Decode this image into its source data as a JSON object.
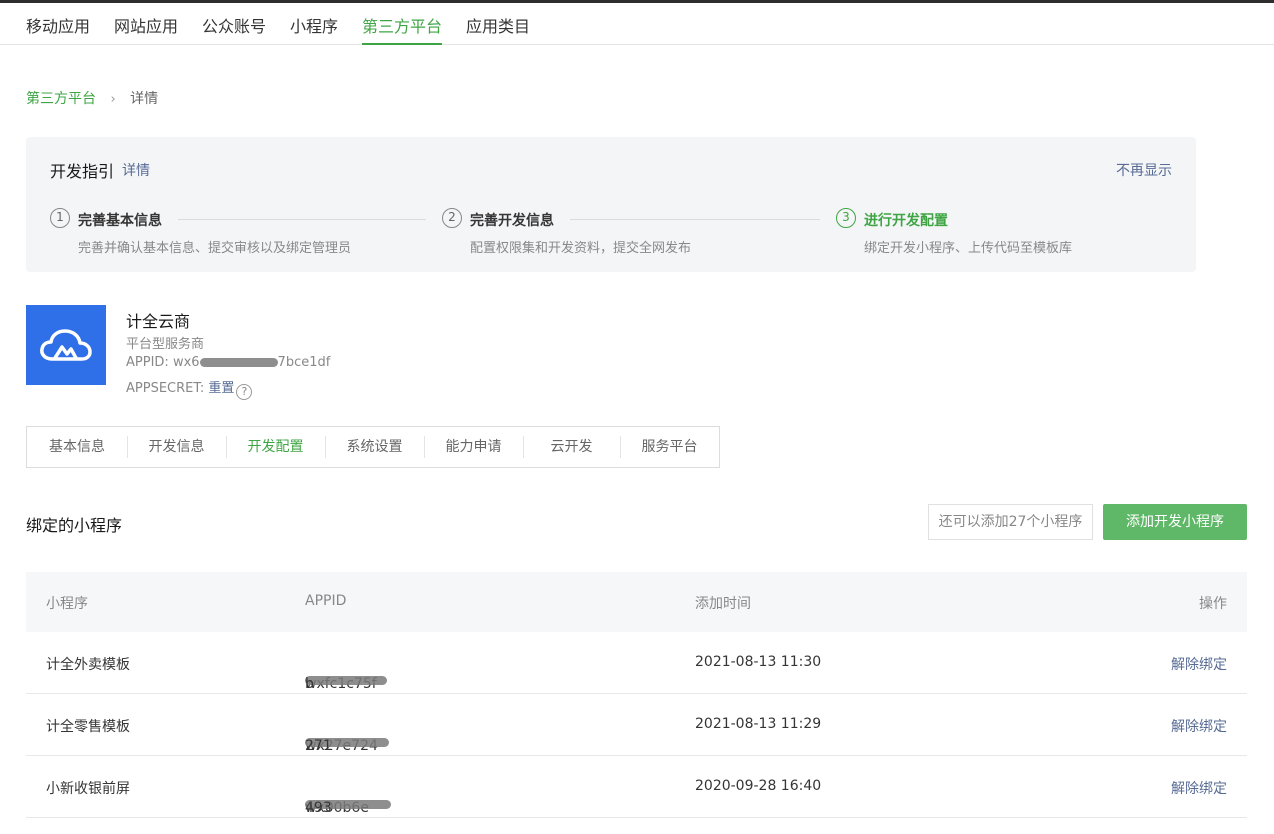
{
  "topnav": {
    "tabs": [
      "移动应用",
      "网站应用",
      "公众账号",
      "小程序",
      "第三方平台",
      "应用类目"
    ],
    "active": "第三方平台"
  },
  "breadcrumb": {
    "parent": "第三方平台",
    "separator": "›",
    "current": "详情"
  },
  "guide": {
    "title": "开发指引",
    "detail_link": "详情",
    "hide_link": "不再显示",
    "steps": [
      {
        "num": "1",
        "title": "完善基本信息",
        "desc": "完善并确认基本信息、提交审核以及绑定管理员"
      },
      {
        "num": "2",
        "title": "完善开发信息",
        "desc": "配置权限集和开发资料，提交全网发布"
      },
      {
        "num": "3",
        "title": "进行开发配置",
        "desc": "绑定开发小程序、上传代码至模板库"
      }
    ]
  },
  "platform": {
    "name": "计全云商",
    "type": "平台型服务商",
    "appid_label": "APPID: ",
    "appid_prefix": "wx6",
    "appid_suffix": "7bce1df",
    "appsecret_label": "APPSECRET: ",
    "reset_link": "重置",
    "help_icon": "?"
  },
  "subtabs": {
    "items": [
      "基本信息",
      "开发信息",
      "开发配置",
      "系统设置",
      "能力申请",
      "云开发",
      "服务平台"
    ],
    "active": "开发配置"
  },
  "bound": {
    "title": "绑定的小程序",
    "remain_text": "还可以添加27个小程序",
    "add_button": "添加开发小程序"
  },
  "table": {
    "headers": [
      "小程序",
      "APPID",
      "添加时间",
      "操作"
    ],
    "rows": [
      {
        "name": "计全外卖模板",
        "appid_prefix": "wxfc1c75f",
        "appid_suffix": "b",
        "time": "2021-08-13 11:30",
        "action": "解除绑定"
      },
      {
        "name": "计全零售模板",
        "appid_prefix": "wx27e724",
        "appid_suffix": "271",
        "time": "2021-08-13 11:29",
        "action": "解除绑定"
      },
      {
        "name": "小新收银前屏",
        "appid_prefix": "wx00b6e",
        "appid_suffix": "493",
        "time": "2020-09-28 16:40",
        "action": "解除绑定"
      }
    ]
  },
  "colors": {
    "accent_green": "#3fa544",
    "link_blue": "#576b95",
    "logo_blue": "#2f6fe8"
  }
}
